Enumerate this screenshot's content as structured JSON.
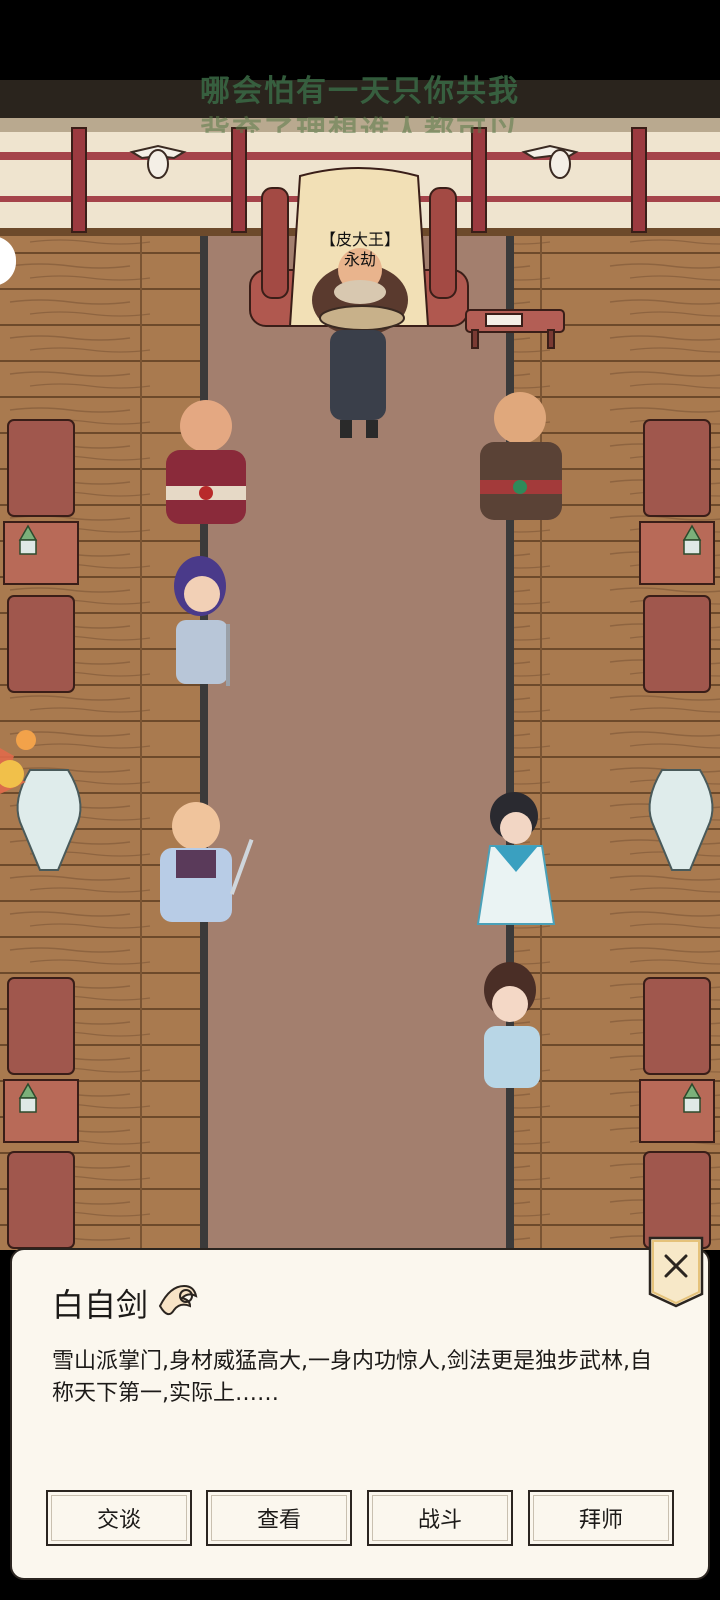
{
  "lyrics": {
    "line1": "哪会怕有一天只你共我",
    "line2": "背弃了理想谁人都可以"
  },
  "boss_tag": {
    "title": "【皮大王】",
    "name": "永劫"
  },
  "dialog": {
    "npc_name": "白自剑",
    "description": "雪山派掌门,身材威猛高大,一身内功惊人,剑法更是独步武林,自称天下第一,实际上……",
    "buttons": {
      "talk": "交谈",
      "view": "查看",
      "fight": "战斗",
      "apprentice": "拜师"
    },
    "close_icon": "close-icon"
  },
  "colors": {
    "floor": "#a97a4f",
    "carpet": "#a37f6e",
    "wall": "#efe4cf",
    "dialog_bg": "#fbf7ee",
    "accent_gold": "#e5c27a"
  }
}
